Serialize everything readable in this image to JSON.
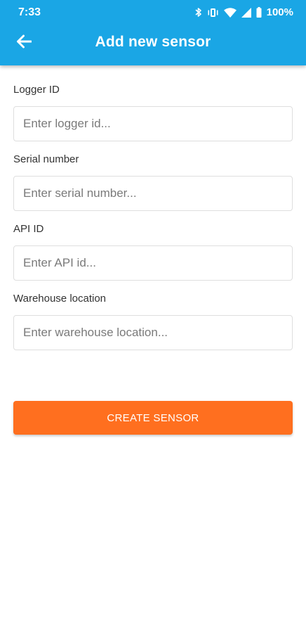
{
  "status_bar": {
    "time": "7:33",
    "battery": "100%",
    "icons": [
      "bluetooth-icon",
      "vibrate-icon",
      "wifi-icon",
      "signal-icon",
      "battery-icon"
    ]
  },
  "header": {
    "back_icon": "arrow-left-icon",
    "title": "Add new sensor",
    "background_color": "#1aa6e5"
  },
  "form": {
    "logger_id": {
      "label": "Logger ID",
      "value": "",
      "placeholder": "Enter logger id..."
    },
    "serial_number": {
      "label": "Serial number",
      "value": "",
      "placeholder": "Enter serial number..."
    },
    "api_id": {
      "label": "API ID",
      "value": "",
      "placeholder": "Enter API id..."
    },
    "warehouse_location": {
      "label": "Warehouse location",
      "value": "",
      "placeholder": "Enter warehouse location..."
    }
  },
  "actions": {
    "create_label": "CREATE SENSOR",
    "create_color": "#ff6f1f"
  }
}
